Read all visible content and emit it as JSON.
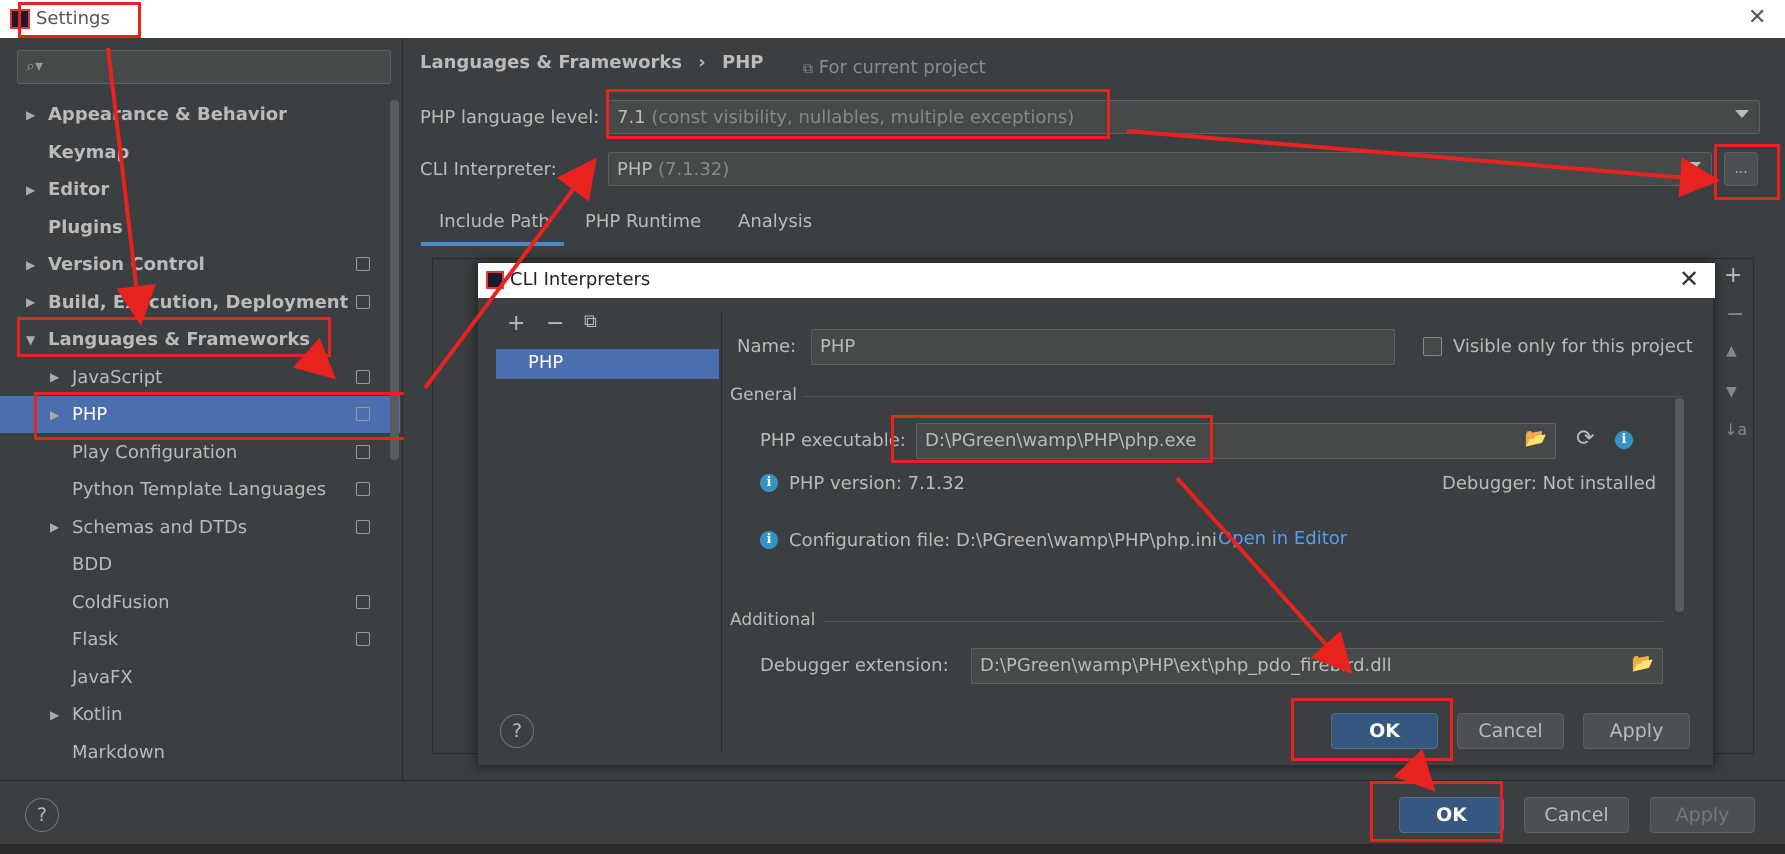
{
  "window": {
    "title": "Settings"
  },
  "sidebar": {
    "search_placeholder": "",
    "items": [
      {
        "label": "Appearance & Behavior",
        "arrow": "▶",
        "bold": true
      },
      {
        "label": "Keymap",
        "arrow": "",
        "bold": true
      },
      {
        "label": "Editor",
        "arrow": "▶",
        "bold": true
      },
      {
        "label": "Plugins",
        "arrow": "",
        "bold": true
      },
      {
        "label": "Version Control",
        "arrow": "▶",
        "bold": true
      },
      {
        "label": "Build, Execution, Deployment",
        "arrow": "▶",
        "bold": true
      },
      {
        "label": "Languages & Frameworks",
        "arrow": "▼",
        "bold": true
      },
      {
        "label": "JavaScript",
        "arrow": "▶"
      },
      {
        "label": "PHP",
        "arrow": "▶",
        "selected": true
      },
      {
        "label": "Play Configuration",
        "arrow": ""
      },
      {
        "label": "Python Template Languages",
        "arrow": ""
      },
      {
        "label": "Schemas and DTDs",
        "arrow": "▶"
      },
      {
        "label": "BDD",
        "arrow": ""
      },
      {
        "label": "ColdFusion",
        "arrow": ""
      },
      {
        "label": "Flask",
        "arrow": ""
      },
      {
        "label": "JavaFX",
        "arrow": ""
      },
      {
        "label": "Kotlin",
        "arrow": "▶"
      },
      {
        "label": "Markdown",
        "arrow": ""
      }
    ]
  },
  "main": {
    "breadcrumb": {
      "parent": "Languages & Frameworks",
      "sep": "›",
      "current": "PHP"
    },
    "scope": "For current project",
    "php_level_label": "PHP language level:",
    "php_level_value": "7.1",
    "php_level_hint": "(const visibility, nullables, multiple exceptions)",
    "cli_label": "CLI Interpreter:",
    "cli_value": "PHP",
    "cli_hint": "(7.1.32)",
    "more_button": "...",
    "tabs": [
      "Include Path",
      "PHP Runtime",
      "Analysis"
    ]
  },
  "dialog": {
    "title": "CLI Interpreters",
    "list": [
      "PHP"
    ],
    "name_label": "Name:",
    "name_value": "PHP",
    "visible_label": "Visible only for this project",
    "general": "General",
    "exe_label": "PHP executable:",
    "exe_value": "D:\\PGreen\\wamp\\PHP\\php.exe",
    "version": "PHP version: 7.1.32",
    "debugger": "Debugger:",
    "debugger_value": "Not installed",
    "config": "Configuration file: D:\\PGreen\\wamp\\PHP\\php.ini",
    "open_editor": "Open in Editor",
    "additional": "Additional",
    "debug_ext_label": "Debugger extension:",
    "debug_ext_value": "D:\\PGreen\\wamp\\PHP\\ext\\php_pdo_firebird.dll",
    "ok": "OK",
    "cancel": "Cancel",
    "apply": "Apply",
    "help": "?"
  },
  "footer": {
    "ok": "OK",
    "cancel": "Cancel",
    "apply": "Apply",
    "help": "?"
  },
  "colors": {
    "annotation": "#e8231f",
    "selection": "#4b6eaf",
    "accent": "#365880"
  }
}
